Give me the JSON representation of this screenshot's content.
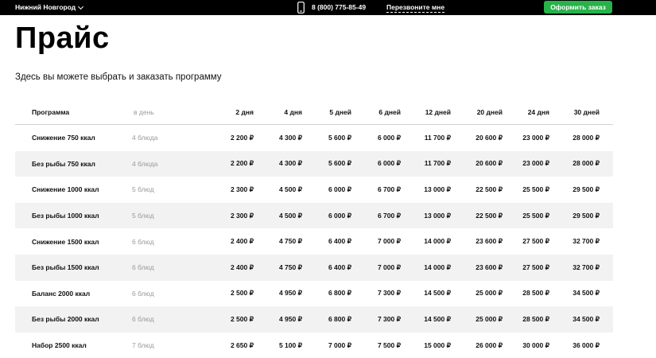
{
  "header": {
    "city": "Нижний Новгород",
    "phone": "8 (800) 775-85-49",
    "callback": "Перезвоните мне",
    "order_button": "Оформить заказ"
  },
  "page": {
    "title": "Прайс",
    "subtitle": "Здесь вы можете выбрать и заказать программу"
  },
  "table": {
    "columns": [
      "Программа",
      "в день",
      "2 дня",
      "4 дня",
      "5 дней",
      "6 дней",
      "12 дней",
      "20 дней",
      "24 дня",
      "30 дней"
    ],
    "rows": [
      [
        "Снижение 750 ккал",
        "4 блюда",
        "2 200 ₽",
        "4 300 ₽",
        "5 600 ₽",
        "6 000 ₽",
        "11 700 ₽",
        "20 600 ₽",
        "23 000 ₽",
        "28 000 ₽"
      ],
      [
        "Без рыбы 750 ккал",
        "4 блюда",
        "2 200 ₽",
        "4 300 ₽",
        "5 600 ₽",
        "6 000 ₽",
        "11 700 ₽",
        "20 600 ₽",
        "23 000 ₽",
        "28 000 ₽"
      ],
      [
        "Снижение 1000 ккал",
        "5 блюд",
        "2 300 ₽",
        "4 500 ₽",
        "6 000 ₽",
        "6 700 ₽",
        "13 000 ₽",
        "22 500 ₽",
        "25 500 ₽",
        "29 500 ₽"
      ],
      [
        "Без рыбы 1000 ккал",
        "5 блюд",
        "2 300 ₽",
        "4 500 ₽",
        "6 000 ₽",
        "6 700 ₽",
        "13 000 ₽",
        "22 500 ₽",
        "25 500 ₽",
        "29 500 ₽"
      ],
      [
        "Снижение 1500 ккал",
        "6 блюд",
        "2 400 ₽",
        "4 750 ₽",
        "6 400 ₽",
        "7 000 ₽",
        "14 000 ₽",
        "23 600 ₽",
        "27 500 ₽",
        "32 700 ₽"
      ],
      [
        "Без рыбы 1500 ккал",
        "6 блюд",
        "2 400 ₽",
        "4 750 ₽",
        "6 400 ₽",
        "7 000 ₽",
        "14 000 ₽",
        "23 600 ₽",
        "27 500 ₽",
        "32 700 ₽"
      ],
      [
        "Баланс 2000 ккал",
        "6 блюд",
        "2 500 ₽",
        "4 950 ₽",
        "6 800 ₽",
        "7 300 ₽",
        "14 500 ₽",
        "25 000 ₽",
        "28 500 ₽",
        "34 500 ₽"
      ],
      [
        "Без рыбы 2000 ккал",
        "6 блюд",
        "2 500 ₽",
        "4 950 ₽",
        "6 800 ₽",
        "7 300 ₽",
        "14 500 ₽",
        "25 000 ₽",
        "28 500 ₽",
        "34 500 ₽"
      ],
      [
        "Набор 2500 ккал",
        "7 блюд",
        "2 650 ₽",
        "5 100 ₽",
        "7 000 ₽",
        "7 500 ₽",
        "15 000 ₽",
        "26 000 ₽",
        "30 000 ₽",
        "36 000 ₽"
      ]
    ]
  },
  "colors": {
    "topbar": "#000000",
    "accent_button": "#27b24a",
    "row_alt": "#f2f2f2",
    "muted_text": "#9a9a9a"
  },
  "icons": {
    "phone": "phone-icon",
    "city_chevron": "chevron-down-icon"
  }
}
